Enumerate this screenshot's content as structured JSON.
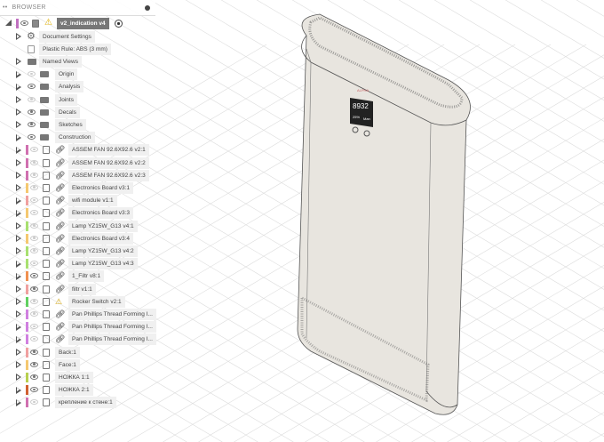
{
  "browser": {
    "title": "BROWSER",
    "root": "v2_indication v4",
    "items": [
      {
        "label": "Document Settings",
        "type": "settings"
      },
      {
        "label": "Plastic Rule: ABS (3 mm)",
        "type": "rule"
      },
      {
        "label": "Named Views",
        "type": "folder"
      },
      {
        "label": "Origin",
        "type": "folder",
        "eye": "off"
      },
      {
        "label": "Analysis",
        "type": "folder",
        "eye": "on"
      },
      {
        "label": "Joints",
        "type": "folder",
        "eye": "off"
      },
      {
        "label": "Decals",
        "type": "folder",
        "eye": "on"
      },
      {
        "label": "Sketches",
        "type": "folder",
        "eye": "on"
      },
      {
        "label": "Construction",
        "type": "folder",
        "eye": "on"
      },
      {
        "label": "ASSEM FAN 92.6X92.6 v2:1",
        "type": "link",
        "eye": "off",
        "color": "#d070b0"
      },
      {
        "label": "ASSEM FAN 92.6X92.6 v2:2",
        "type": "link",
        "eye": "off",
        "color": "#d070b0"
      },
      {
        "label": "ASSEM FAN 92.6X92.6 v2:3",
        "type": "link",
        "eye": "off",
        "color": "#d070b0"
      },
      {
        "label": "Electronics Board v3:1",
        "type": "link",
        "eye": "off",
        "color": "#f5c870"
      },
      {
        "label": "wifi module v1:1",
        "type": "link",
        "eye": "off",
        "color": "#f0a0a0"
      },
      {
        "label": "Electronics Board v3:3",
        "type": "link",
        "eye": "off",
        "color": "#f5c870"
      },
      {
        "label": "Lamp YZ15W_G13 v4:1",
        "type": "link",
        "eye": "off",
        "color": "#a8e070"
      },
      {
        "label": "Electronics Board v3:4",
        "type": "link",
        "eye": "off",
        "color": "#f5c870"
      },
      {
        "label": "Lamp YZ15W_G13 v4:2",
        "type": "link",
        "eye": "off",
        "color": "#a8e070"
      },
      {
        "label": "Lamp YZ15W_G13 v4:3",
        "type": "link",
        "eye": "off",
        "color": "#a8e070"
      },
      {
        "label": "1_Filtr v8:1",
        "type": "link",
        "eye": "on",
        "color": "#f09050"
      },
      {
        "label": "filtr v1:1",
        "type": "link",
        "eye": "on",
        "color": "#f0a0a0"
      },
      {
        "label": "Rocker Switch v2:1",
        "type": "warn",
        "eye": "off",
        "color": "#60d060"
      },
      {
        "label": "Pan Phillips Thread Forming I...",
        "type": "link",
        "eye": "off",
        "color": "#d080e0"
      },
      {
        "label": "Pan Phillips Thread Forming I...",
        "type": "link",
        "eye": "off",
        "color": "#d080e0"
      },
      {
        "label": "Pan Phillips Thread Forming I...",
        "type": "link",
        "eye": "off",
        "color": "#d080e0"
      },
      {
        "label": "Back:1",
        "type": "comp",
        "eye": "on",
        "color": "#f0a0a0"
      },
      {
        "label": "Face:1",
        "type": "comp",
        "eye": "on",
        "color": "#f5c870"
      },
      {
        "label": "НОЖКА 1:1",
        "type": "comp",
        "eye": "on",
        "color": "#b8d050"
      },
      {
        "label": "НОЖКА 2:1",
        "type": "comp",
        "eye": "on",
        "color": "#d06030"
      },
      {
        "label": "крепление к стене:1",
        "type": "comp",
        "eye": "off",
        "color": "#d070b0"
      }
    ]
  },
  "device": {
    "logo": "ALPHA",
    "display_value": "8932",
    "display_percent": "25%",
    "display_mode": "Man"
  }
}
